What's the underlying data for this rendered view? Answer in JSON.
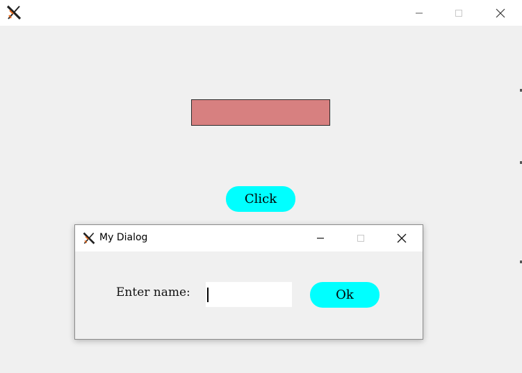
{
  "main_window": {
    "title": "",
    "icon": "x-app-icon",
    "controls": {
      "minimize": "minimize-icon",
      "maximize": "maximize-icon",
      "close": "close-icon"
    },
    "color_rect": {
      "fill": "#d78080"
    },
    "click_button": {
      "label": "Click",
      "color": "#00ffff"
    }
  },
  "dialog": {
    "title": "My Dialog",
    "icon": "x-app-icon",
    "name_label": "Enter name:",
    "name_input": {
      "value": "",
      "placeholder": ""
    },
    "ok_button": {
      "label": "Ok",
      "color": "#00ffff"
    },
    "controls": {
      "minimize": "minimize-icon",
      "maximize": "maximize-icon",
      "close": "close-icon"
    }
  }
}
